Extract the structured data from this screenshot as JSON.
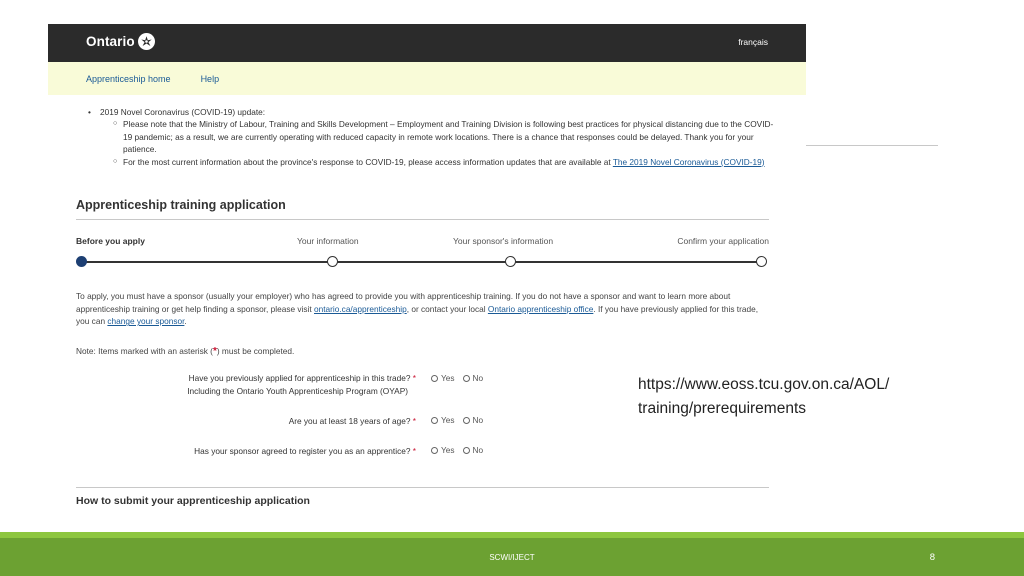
{
  "header": {
    "logo_text": "Ontario",
    "lang_link": "français"
  },
  "nav": {
    "items": [
      "Apprenticeship home",
      "Help"
    ]
  },
  "covid": {
    "title": "2019 Novel Coronavirus (COVID-19) update:",
    "item1": "Please note that the Ministry of Labour, Training and Skills Development – Employment and Training Division is following best practices for physical distancing due to the COVID-19 pandemic; as a result, we are currently operating with reduced capacity in remote work locations. There is a chance that responses could be delayed. Thank you for your patience.",
    "item2_text": "For the most current information about the province's response to COVID-19, please access information updates that are available at ",
    "item2_link": "The 2019 Novel Coronavirus (COVID-19)"
  },
  "form": {
    "title": "Apprenticeship training application",
    "steps": [
      "Before you apply",
      "Your information",
      "Your sponsor's information",
      "Confirm your application"
    ],
    "active_step": 0,
    "intro_1": "To apply, you must have a sponsor (usually your employer) who has agreed to provide you with apprenticeship training. If you do not have a sponsor and want to learn more about apprenticeship training or get help finding a sponsor, please visit ",
    "intro_link1": "ontario.ca/apprenticeship",
    "intro_2": ", or contact your local ",
    "intro_link2": "Ontario apprenticeship office",
    "intro_3": ". If you have previously applied for this trade, you can ",
    "intro_link3": "change your sponsor",
    "intro_4": ".",
    "note_before": "Note: Items marked with an asterisk (",
    "note_star": "*",
    "note_after": ") must be completed.",
    "questions": [
      {
        "line1": "Have you previously applied for apprenticeship in this trade?",
        "line2": "Including the Ontario Youth Apprenticeship Program (OYAP)",
        "req": "*"
      },
      {
        "line1": "Are you at least 18 years of age?",
        "req": "*"
      },
      {
        "line1": "Has your sponsor agreed to register you as an apprentice?",
        "req": "*"
      }
    ],
    "yes_label": "Yes",
    "no_label": "No",
    "section_title": "How to submit your apprenticeship application"
  },
  "slide": {
    "url_line1": "https://www.eoss.tcu.gov.on.ca/AOL/",
    "url_line2": "training/prerequirements",
    "footer_text": "SCWI/IJECT",
    "page_number": "8",
    "colors": {
      "footer_green": "#6ca132",
      "footer_strip": "#8dc63f",
      "header_dark": "#2b2b2b",
      "nav_bg": "#f9fbd8",
      "link": "#1a5a96",
      "step_active": "#1d3f73"
    }
  }
}
